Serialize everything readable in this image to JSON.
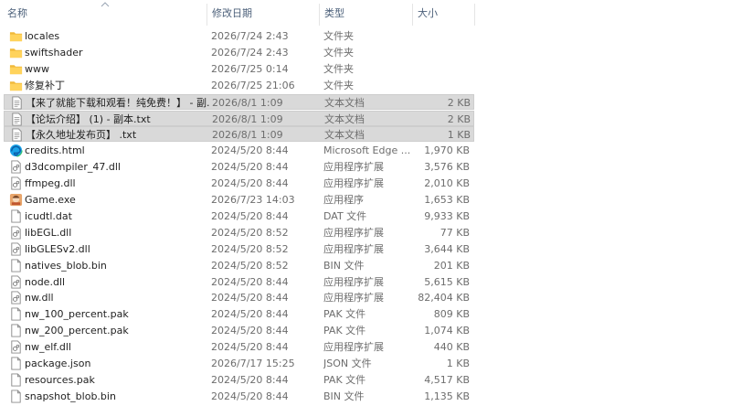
{
  "columns": {
    "name": "名称",
    "date": "修改日期",
    "type": "类型",
    "size": "大小"
  },
  "files": [
    {
      "name": "locales",
      "date": "2026/7/24 2:43",
      "type": "文件夹",
      "size": "",
      "icon": "folder-icon",
      "selected": false
    },
    {
      "name": "swiftshader",
      "date": "2026/7/24 2:43",
      "type": "文件夹",
      "size": "",
      "icon": "folder-icon",
      "selected": false
    },
    {
      "name": "www",
      "date": "2026/7/25 0:14",
      "type": "文件夹",
      "size": "",
      "icon": "folder-icon",
      "selected": false
    },
    {
      "name": "修复补丁",
      "date": "2026/7/25 21:06",
      "type": "文件夹",
      "size": "",
      "icon": "folder-icon",
      "selected": false
    },
    {
      "name": "【来了就能下载和观看！纯免费！】 - 副...",
      "date": "2026/8/1 1:09",
      "type": "文本文档",
      "size": "2 KB",
      "icon": "text-file-icon",
      "selected": true
    },
    {
      "name": "【论坛介绍】 (1) - 副本.txt",
      "date": "2026/8/1 1:09",
      "type": "文本文档",
      "size": "2 KB",
      "icon": "text-file-icon",
      "selected": true
    },
    {
      "name": "【永久地址发布页】 .txt",
      "date": "2026/8/1 1:09",
      "type": "文本文档",
      "size": "1 KB",
      "icon": "text-file-icon",
      "selected": true
    },
    {
      "name": "credits.html",
      "date": "2024/5/20 8:44",
      "type": "Microsoft Edge ...",
      "size": "1,970 KB",
      "icon": "edge-html-icon",
      "selected": false
    },
    {
      "name": "d3dcompiler_47.dll",
      "date": "2024/5/20 8:44",
      "type": "应用程序扩展",
      "size": "3,576 KB",
      "icon": "dll-file-icon",
      "selected": false
    },
    {
      "name": "ffmpeg.dll",
      "date": "2024/5/20 8:44",
      "type": "应用程序扩展",
      "size": "2,010 KB",
      "icon": "dll-file-icon",
      "selected": false
    },
    {
      "name": "Game.exe",
      "date": "2026/7/23 14:03",
      "type": "应用程序",
      "size": "1,653 KB",
      "icon": "game-exe-icon",
      "selected": false
    },
    {
      "name": "icudtl.dat",
      "date": "2024/5/20 8:44",
      "type": "DAT 文件",
      "size": "9,933 KB",
      "icon": "blank-file-icon",
      "selected": false
    },
    {
      "name": "libEGL.dll",
      "date": "2024/5/20 8:52",
      "type": "应用程序扩展",
      "size": "77 KB",
      "icon": "dll-file-icon",
      "selected": false
    },
    {
      "name": "libGLESv2.dll",
      "date": "2024/5/20 8:52",
      "type": "应用程序扩展",
      "size": "3,644 KB",
      "icon": "dll-file-icon",
      "selected": false
    },
    {
      "name": "natives_blob.bin",
      "date": "2024/5/20 8:52",
      "type": "BIN 文件",
      "size": "201 KB",
      "icon": "blank-file-icon",
      "selected": false
    },
    {
      "name": "node.dll",
      "date": "2024/5/20 8:44",
      "type": "应用程序扩展",
      "size": "5,615 KB",
      "icon": "dll-file-icon",
      "selected": false
    },
    {
      "name": "nw.dll",
      "date": "2024/5/20 8:44",
      "type": "应用程序扩展",
      "size": "82,404 KB",
      "icon": "dll-file-icon",
      "selected": false
    },
    {
      "name": "nw_100_percent.pak",
      "date": "2024/5/20 8:44",
      "type": "PAK 文件",
      "size": "809 KB",
      "icon": "blank-file-icon",
      "selected": false
    },
    {
      "name": "nw_200_percent.pak",
      "date": "2024/5/20 8:44",
      "type": "PAK 文件",
      "size": "1,074 KB",
      "icon": "blank-file-icon",
      "selected": false
    },
    {
      "name": "nw_elf.dll",
      "date": "2024/5/20 8:44",
      "type": "应用程序扩展",
      "size": "440 KB",
      "icon": "dll-file-icon",
      "selected": false
    },
    {
      "name": "package.json",
      "date": "2026/7/17 15:25",
      "type": "JSON 文件",
      "size": "1 KB",
      "icon": "blank-file-icon",
      "selected": false
    },
    {
      "name": "resources.pak",
      "date": "2024/5/20 8:44",
      "type": "PAK 文件",
      "size": "4,517 KB",
      "icon": "blank-file-icon",
      "selected": false
    },
    {
      "name": "snapshot_blob.bin",
      "date": "2024/5/20 8:44",
      "type": "BIN 文件",
      "size": "1,135 KB",
      "icon": "blank-file-icon",
      "selected": false
    }
  ]
}
